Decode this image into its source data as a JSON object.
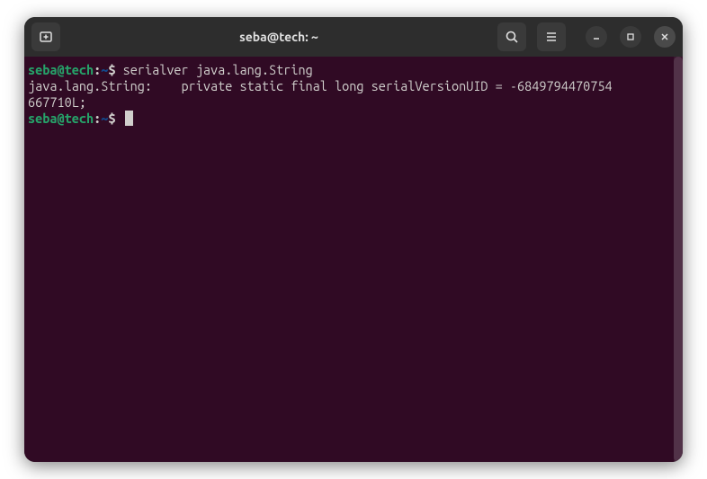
{
  "titlebar": {
    "title": "seba@tech: ~"
  },
  "terminal": {
    "prompt1": {
      "user_host": "seba@tech",
      "separator": ":",
      "path": "~",
      "symbol": "$"
    },
    "command1": "serialver java.lang.String",
    "output_line1": "java.lang.String:    private static final long serialVersionUID = -6849794470754",
    "output_line2": "667710L;",
    "prompt2": {
      "user_host": "seba@tech",
      "separator": ":",
      "path": "~",
      "symbol": "$"
    }
  },
  "colors": {
    "terminal_bg": "#300a24",
    "titlebar_bg": "#2d2d2d",
    "prompt_green": "#26a269",
    "prompt_blue": "#12488b",
    "text": "#d0cfcc"
  }
}
